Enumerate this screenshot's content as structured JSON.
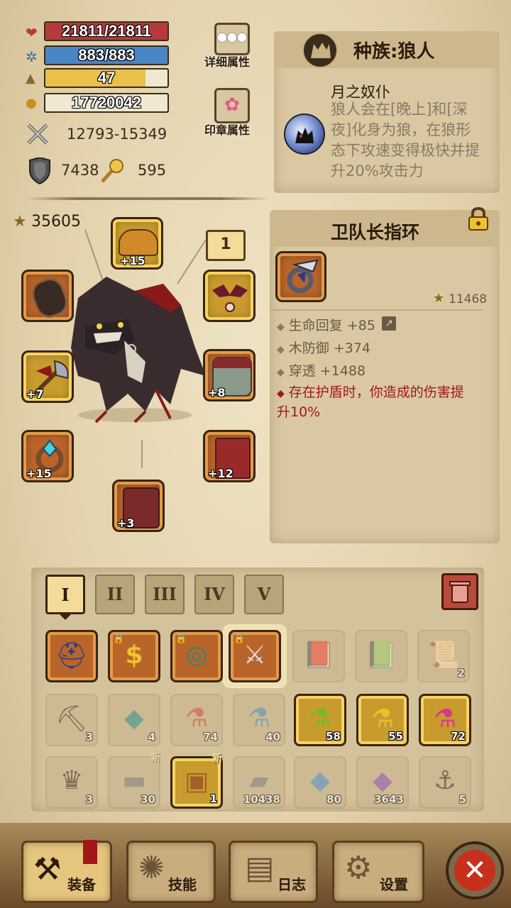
{
  "stats": {
    "hp": "21811/21811",
    "mana": "883/883",
    "level": "47",
    "level_progress": 0.82,
    "gold": "17720042",
    "attack": "12793-15349",
    "defense": "7438",
    "magic": "595"
  },
  "side_buttons": {
    "details": "详细属性",
    "seal": "印章属性"
  },
  "race": {
    "title": "种族:狼人",
    "skill_name": "月之奴仆",
    "skill_desc": "狼人会在[晚上]和[深夜]化身为狼，在狼形态下攻速变得极快并提升20%攻击力"
  },
  "power": "35605",
  "page_indicator": "1",
  "equipment_slots": [
    {
      "slot": "helmet",
      "level": "+15"
    },
    {
      "slot": "left-amulet",
      "level": ""
    },
    {
      "slot": "bat-charm",
      "level": ""
    },
    {
      "slot": "weapon",
      "level": "+7"
    },
    {
      "slot": "armor",
      "level": "+8"
    },
    {
      "slot": "ring",
      "level": "+15"
    },
    {
      "slot": "pants",
      "level": "+12"
    },
    {
      "slot": "boots",
      "level": "+3"
    }
  ],
  "item_detail": {
    "name": "卫队长指环",
    "score": "11468",
    "attributes": [
      "生命回复 +85",
      "木防御 +374",
      "穿透 +1488"
    ],
    "special": "存在护盾时，你造成的伤害提升10%"
  },
  "tabs": [
    "I",
    "II",
    "III",
    "IV",
    "V"
  ],
  "inventory": [
    {
      "icon": "horned-helm",
      "count": "",
      "state": "active"
    },
    {
      "icon": "dollar-charm",
      "count": "",
      "state": "active"
    },
    {
      "icon": "jade-ring",
      "count": "",
      "state": "active"
    },
    {
      "icon": "guard-ring",
      "count": "",
      "state": "selected"
    },
    {
      "icon": "spellbook",
      "count": "",
      "state": "dim"
    },
    {
      "icon": "tome",
      "count": "",
      "state": "dim"
    },
    {
      "icon": "scroll",
      "count": "2",
      "state": "dim"
    },
    {
      "icon": "pickaxe",
      "count": "3",
      "state": "dim"
    },
    {
      "icon": "cat-mask",
      "count": "4",
      "state": "dim"
    },
    {
      "icon": "red-potion",
      "count": "74",
      "state": "dim"
    },
    {
      "icon": "blue-potion",
      "count": "40",
      "state": "dim"
    },
    {
      "icon": "green-potion",
      "count": "58",
      "state": "gold"
    },
    {
      "icon": "yellow-potion",
      "count": "55",
      "state": "gold"
    },
    {
      "icon": "pink-potion",
      "count": "72",
      "state": "gold"
    },
    {
      "icon": "crown",
      "count": "3",
      "state": "dim"
    },
    {
      "icon": "stone",
      "count": "30",
      "state": "dim",
      "new": "新"
    },
    {
      "icon": "treasure-chest",
      "count": "1",
      "state": "gold",
      "new": "新"
    },
    {
      "icon": "ingot",
      "count": "10438",
      "state": "dim"
    },
    {
      "icon": "crystal",
      "count": "80",
      "state": "dim"
    },
    {
      "icon": "amethyst",
      "count": "3643",
      "state": "dim"
    },
    {
      "icon": "hook",
      "count": "5",
      "state": "dim"
    }
  ],
  "nav": {
    "equip": "装备",
    "skills": "技能",
    "log": "日志",
    "settings": "设置"
  },
  "colors": {
    "hp": "#b8393b",
    "mana": "#4a86c4",
    "level": "#e8c04a",
    "special_text": "#a3161a"
  }
}
